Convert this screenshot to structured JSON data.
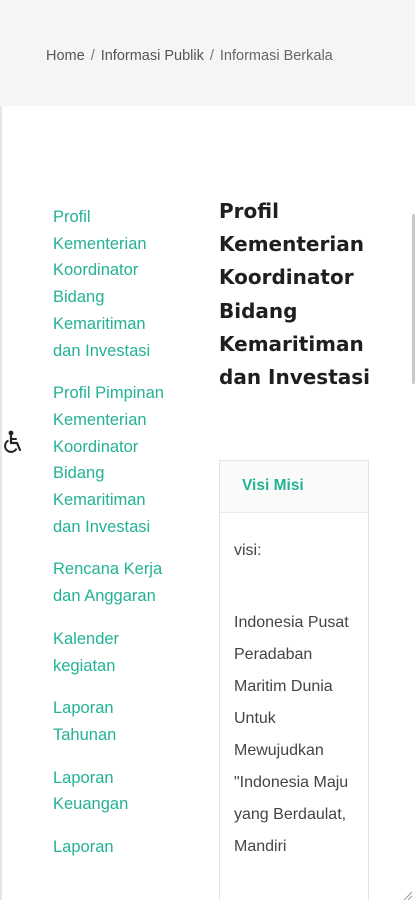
{
  "breadcrumb": {
    "items": [
      "Home",
      "Informasi Publik",
      "Informasi Berkala"
    ],
    "separator": "/"
  },
  "sidebar": {
    "items": [
      {
        "label": "Profil Kementerian Koordinator Bidang Kemaritiman dan Investasi"
      },
      {
        "label": "Profil Pimpinan Kementerian Koordinator Bidang Kemaritiman dan Investasi"
      },
      {
        "label": "Rencana Kerja dan Anggaran"
      },
      {
        "label": "Kalender kegiatan"
      },
      {
        "label": "Laporan Tahunan"
      },
      {
        "label": "Laporan Keuangan"
      },
      {
        "label": "Laporan"
      }
    ]
  },
  "main": {
    "title": "Profil Kementerian Koordinator Bidang Kemaritiman dan Investasi",
    "tab_label": "Visi Misi",
    "visi_label": "visi:",
    "visi_text": "Indonesia Pusat Peradaban Maritim Dunia Untuk Mewujudkan \"Indonesia Maju yang Berdaulat, Mandiri"
  },
  "accessibility": {
    "icon": "accessibility-icon"
  },
  "colors": {
    "accent": "#24b294",
    "breadcrumb_bg": "#f5f5f5",
    "title": "#1f1f1f",
    "body_text": "#444444"
  }
}
